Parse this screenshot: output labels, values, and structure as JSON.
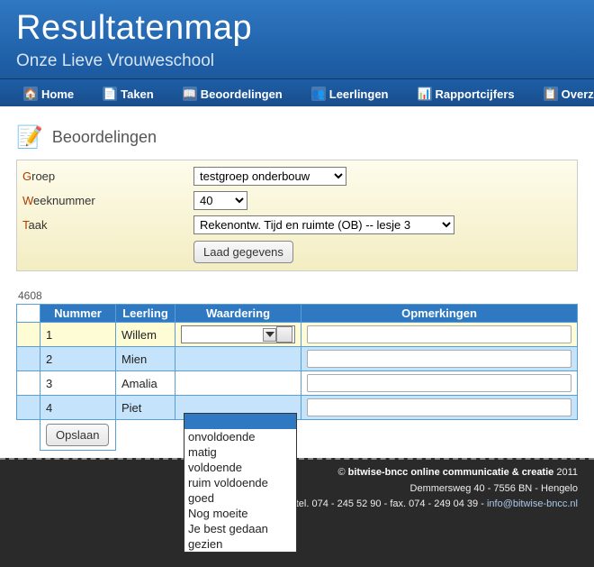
{
  "header": {
    "title": "Resultatenmap",
    "subtitle": "Onze Lieve Vrouweschool"
  },
  "nav": [
    {
      "label": "Home",
      "icon": "ico-home"
    },
    {
      "label": "Taken",
      "icon": "ico-doc"
    },
    {
      "label": "Beoordelingen",
      "icon": "ico-book"
    },
    {
      "label": "Leerlingen",
      "icon": "ico-people"
    },
    {
      "label": "Rapportcijfers",
      "icon": "ico-chart"
    },
    {
      "label": "Overzic",
      "icon": "ico-grid"
    }
  ],
  "section": {
    "title": "Beoordelingen"
  },
  "filters": {
    "groep_label_pre": "G",
    "groep_label_rest": "roep",
    "groep_value": "testgroep onderbouw",
    "week_label_pre": "W",
    "week_label_rest": "eeknummer",
    "week_value": "40",
    "taak_label_pre": "T",
    "taak_label_rest": "aak",
    "taak_value": "Rekenontw. Tijd en ruimte (OB) -- lesje 3",
    "load_button": "Laad gegevens"
  },
  "count": "4608",
  "columns": {
    "nummer": "Nummer",
    "leerling": "Leerling",
    "waardering": "Waardering",
    "opmerkingen": "Opmerkingen"
  },
  "rows": [
    {
      "nummer": "1",
      "leerling": "Willem",
      "waardering": "",
      "opmerking": ""
    },
    {
      "nummer": "2",
      "leerling": "Mien",
      "waardering": "",
      "opmerking": ""
    },
    {
      "nummer": "3",
      "leerling": "Amalia",
      "waardering": "",
      "opmerking": ""
    },
    {
      "nummer": "4",
      "leerling": "Piet",
      "waardering": "",
      "opmerking": ""
    }
  ],
  "waardering_options": [
    "",
    "onvoldoende",
    "matig",
    "voldoende",
    "ruim voldoende",
    "goed",
    "Nog moeite",
    "Je best gedaan",
    "gezien"
  ],
  "save_button": "Opslaan",
  "footer": {
    "line1_prefix": "© ",
    "line1_bold": "bitwise-bncc online communicatie & creatie",
    "line1_suffix": " 2011",
    "line2": "Demmersweg 40 - 7556 BN - Hengelo",
    "line3_prefix": "tel. 074 - 245 52 90 - fax. 074 - 249 04 39 - ",
    "line3_link": "info@bitwise-bncc.nl"
  }
}
